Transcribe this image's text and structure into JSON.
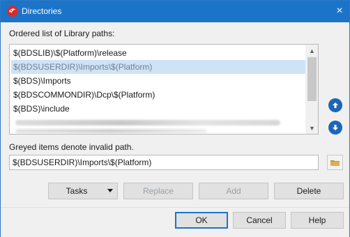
{
  "title": "Directories",
  "labels": {
    "ordered_list": "Ordered list of Library paths:",
    "greyed": "Greyed items denote invalid path."
  },
  "paths": [
    {
      "text": "$(BDSLIB)\\$(Platform)\\release",
      "selected": false
    },
    {
      "text": "$(BDSUSERDIR)\\Imports\\$(Platform)",
      "selected": true
    },
    {
      "text": "$(BDS)\\Imports",
      "selected": false
    },
    {
      "text": "$(BDSCOMMONDIR)\\Dcp\\$(Platform)",
      "selected": false
    },
    {
      "text": "$(BDS)\\include",
      "selected": false
    }
  ],
  "path_input": "$(BDSUSERDIR)\\Imports\\$(Platform)",
  "buttons": {
    "tasks": "Tasks",
    "replace": "Replace",
    "add": "Add",
    "delete": "Delete",
    "ok": "OK",
    "cancel": "Cancel",
    "help": "Help"
  },
  "colors": {
    "titlebar": "#1c74c9",
    "selection": "#cfe3f7",
    "accent": "#1d66b7"
  },
  "icons": [
    "app-logo-icon",
    "close-icon",
    "move-up-icon",
    "move-down-icon",
    "folder-icon",
    "dropdown-arrow-icon"
  ]
}
